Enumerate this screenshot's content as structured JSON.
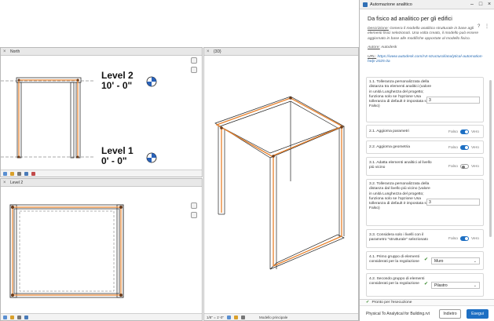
{
  "views": {
    "elevation": {
      "tab_title": "North",
      "level2_name": "Level 2",
      "level2_elev": "10' - 0\"",
      "level1_name": "Level 1",
      "level1_elev": "0' - 0\""
    },
    "plan": {
      "tab_title": "Level 2"
    },
    "three_d": {
      "tab_title": "{3D}",
      "scale": "1/8\" = 1'-0\"",
      "model_label": "Modello principale"
    }
  },
  "panel": {
    "window_title": "Automazione analitico",
    "script_title": "Da fisico ad analitico per gli edifici",
    "description_label": "Descrizione:",
    "description_text": "Genera il modello analitico strutturale in base agli elementi fisici selezionati. Una volta creato, il modello può essere aggiornato in base alle modifiche apportate al modello fisico.",
    "author_label": "Autore:",
    "author_value": "Autodesk",
    "url_label": "URL:",
    "url_value": "https://www.autodesk.com/rvt-structural/analytical-automation-help-2025-ita",
    "params": [
      {
        "label": "1.1. Tolleranza personalizzata della distanza tra elementi analitici (valore in unità Lunghezza del progetto; funziona solo se l'opzione Usa tolleranza di default è impostata su Falso)",
        "value": "3"
      },
      {
        "label": "2.1. Aggiorna parametri",
        "off": "Falso",
        "on": "Vero",
        "state": true
      },
      {
        "label": "2.2. Aggiorna geometria",
        "off": "Falso",
        "on": "Vero",
        "state": true
      },
      {
        "label": "3.1. Adatta elementi analitici al livello più vicino",
        "off": "Falso",
        "on": "Vero",
        "state": false
      },
      {
        "label": "3.2. Tolleranza personalizzata della distanza dal livello più vicino (valore in unità Lunghezza del progetto; funziona solo se l'opzione Usa tolleranza di default è impostata su Falso)",
        "value": "3"
      },
      {
        "label": "3.3. Considera solo i livelli con il parametro \"strutturale\" selezionato",
        "off": "Falso",
        "on": "Vero",
        "state": true
      },
      {
        "label": "4.1. Primo gruppo di elementi considerati per la regolazione",
        "selected": "Muro"
      },
      {
        "label": "4.2. Secondo gruppo di elementi considerati per la regolazione",
        "selected": "Pilastro"
      }
    ],
    "status": "Pronto per l'esecuzione",
    "file_name": "Physical To Analytical for Building.rvt",
    "back_label": "Indietro",
    "run_label": "Esegui"
  },
  "colors": {
    "accent": "#1d6fc3",
    "analytical": "#e8812b",
    "ok": "#3b8b2f"
  }
}
